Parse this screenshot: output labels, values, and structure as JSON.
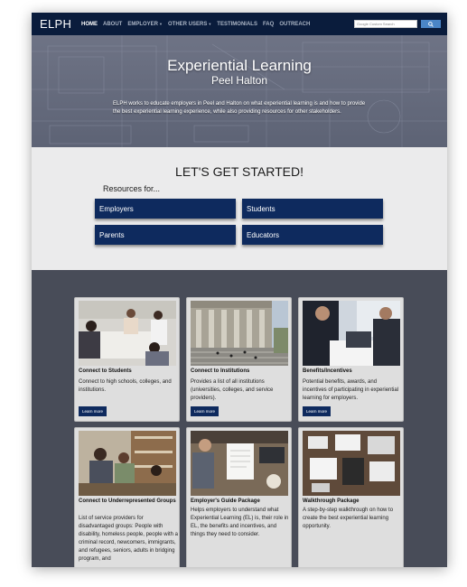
{
  "nav": {
    "brand": "ELPH",
    "links": [
      "HOME",
      "ABOUT",
      "EMPLOYER",
      "OTHER USERS",
      "TESTIMONIALS",
      "FAQ",
      "OUTREACH"
    ],
    "search_placeholder": "Google Custom Search"
  },
  "hero": {
    "title": "Experiential Learning",
    "subtitle": "Peel Halton",
    "description": "ELPH works to educate employers in Peel and Halton on what experiential learning is and how to provide the best experiential learning experience, while also providing resources for other stakeholders."
  },
  "get_started": {
    "title": "LET'S GET STARTED!",
    "resources_label": "Resources for...",
    "buttons": [
      "Employers",
      "Students",
      "Parents",
      "Educators"
    ]
  },
  "cards": [
    {
      "title": "Connect to Students",
      "text": "Connect to high schools, colleges, and institutions.",
      "button": "Learn more"
    },
    {
      "title": "Connect to Institutions",
      "text": "Provides a list of all institutions (universities, colleges, and service providers).",
      "button": "Learn more"
    },
    {
      "title": "Benefits/Incentives",
      "text": "Potential benefits, awards, and incentives of participating in experiential learning for employers.",
      "button": "Learn more"
    },
    {
      "title": "Connect to Underrepresented Groups",
      "text": "List of service providers for disadvantaged groups: People with disability, homeless people, people with a criminal record, newcomers, immigrants, and refugees, seniors, adults in bridging program, and"
    },
    {
      "title": "Employer's Guide Package",
      "text": "Helps employers to understand what Experiential Learning (EL) is, their role in EL, the benefits and incentives, and things they need to consider."
    },
    {
      "title": "Walkthrough Package",
      "text": "A step-by-step walkthrough on how to create the best experiential learning opportunity."
    }
  ],
  "colors": {
    "navbar": "#0a1c3c",
    "button": "#0e2a5e",
    "cards_section": "#484c58",
    "search_button": "#4b86c7"
  }
}
